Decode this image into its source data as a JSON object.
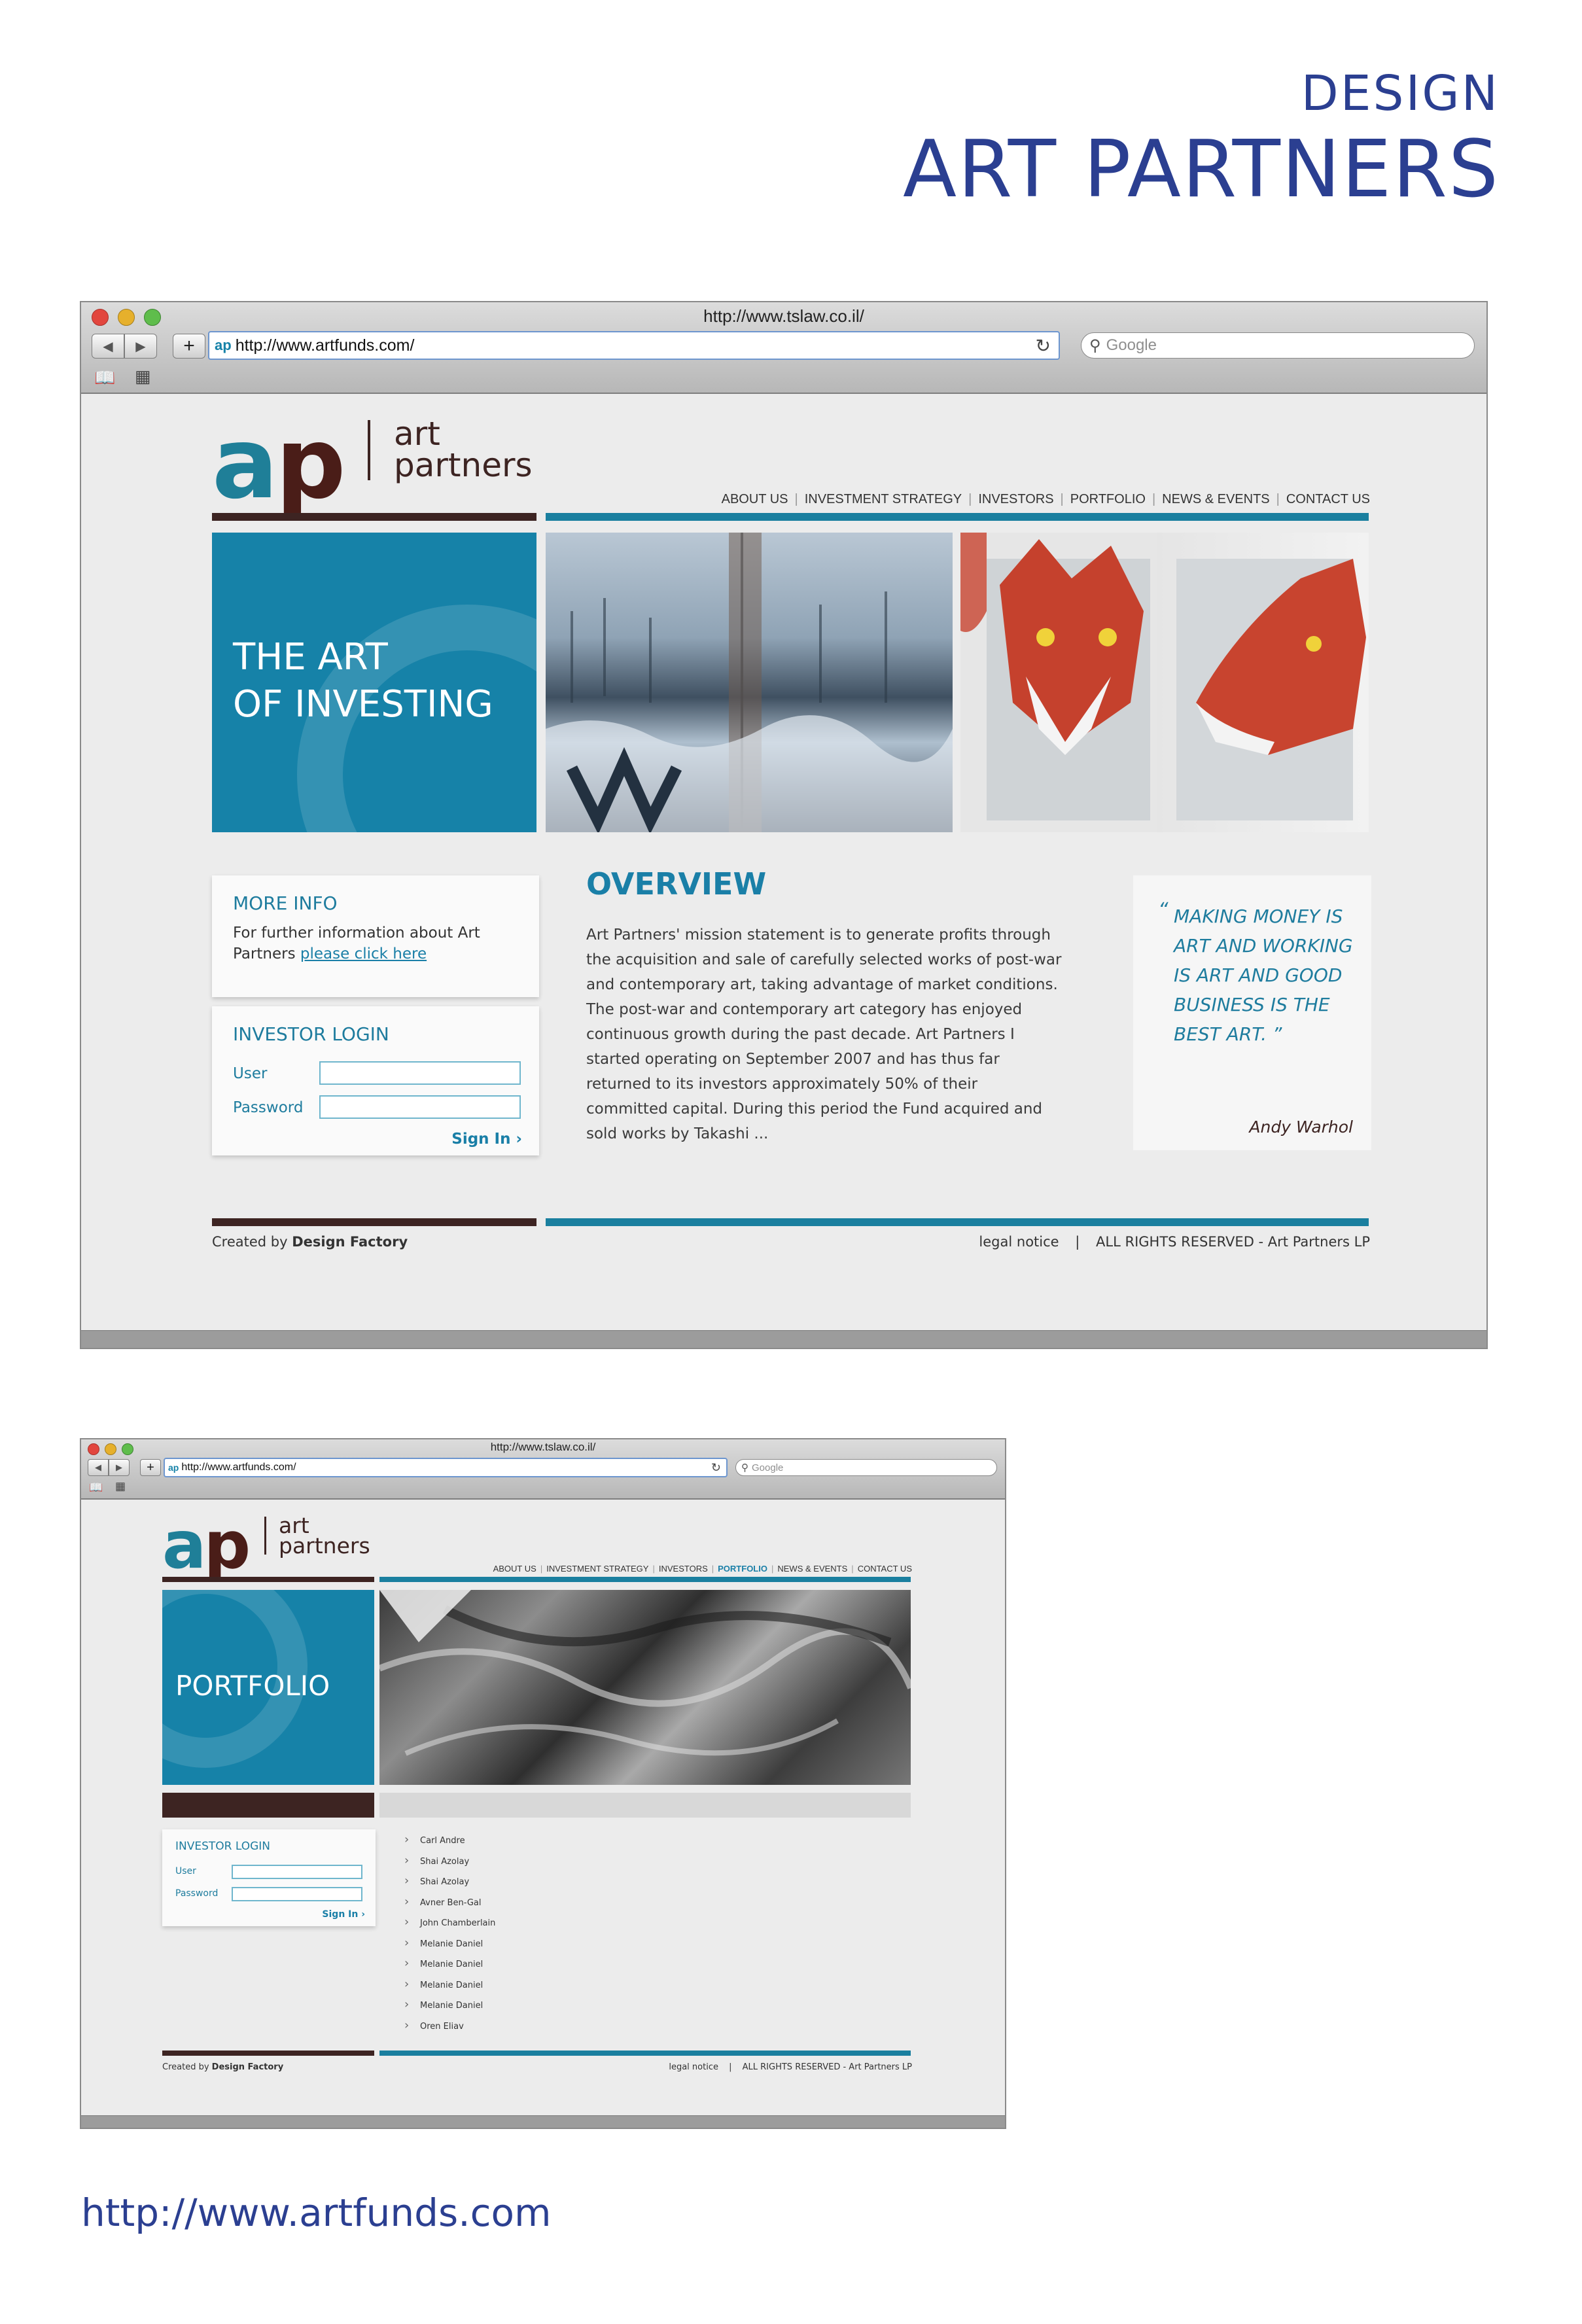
{
  "page": {
    "subtitle": "DESIGN",
    "title": "ART PARTNERS",
    "footer_url": "http://www.artfunds.com"
  },
  "browser": {
    "window_title": "http://www.tslaw.co.il/",
    "url": "http://www.artfunds.com/",
    "search_placeholder": "Google",
    "favicon_text": "ap"
  },
  "site": {
    "logo_mark": "ap",
    "logo_line1": "art",
    "logo_line2": "partners",
    "nav": [
      "ABOUT US",
      "INVESTMENT STRATEGY",
      "INVESTORS",
      "PORTFOLIO",
      "NEWS & EVENTS",
      "CONTACT US"
    ],
    "nav_separator": "|",
    "login": {
      "title": "INVESTOR LOGIN",
      "user_label": "User",
      "password_label": "Password",
      "sign_in": "Sign In",
      "sign_in_arrow": "›"
    },
    "footer": {
      "created_by": "Created by",
      "design_factory": "Design Factory",
      "legal": "legal notice",
      "separator": "|",
      "rights": "ALL RIGHTS RESERVED - Art Partners LP"
    },
    "colors": {
      "accent_blue": "#1682a8",
      "brand_brown": "#3d2422",
      "heading_blue": "#2b3f91"
    }
  },
  "home": {
    "hero_line1": "THE ART",
    "hero_line2": "OF INVESTING",
    "more_info_title": "MORE INFO",
    "more_info_text": "For further information about Art Partners",
    "more_info_link": "please click here",
    "overview_title": "OVERVIEW",
    "overview_lines": [
      "Art Partners' mission statement is to generate profits through",
      "the acquisition and sale of carefully selected works of post-war",
      "and contemporary art, taking advantage of market conditions.",
      "The post-war and contemporary art category has enjoyed",
      "continuous growth during the past decade. Art Partners I",
      "started operating on September 2007 and has thus far",
      "returned to its investors approximately 50% of their",
      "committed capital. During this period the Fund acquired and",
      "sold works by Takashi ..."
    ],
    "quote_lines": [
      "MAKING MONEY IS",
      "ART AND WORKING",
      "IS ART AND GOOD",
      "BUSINESS IS THE",
      "BEST ART."
    ],
    "quote_open": "“",
    "quote_close": "”",
    "quote_author": "Andy Warhol"
  },
  "portfolio": {
    "hero_title": "PORTFOLIO",
    "active_nav": "PORTFOLIO",
    "artists": [
      "Carl Andre",
      "Shai Azolay",
      "Shai Azolay",
      "Avner Ben-Gal",
      "John Chamberlain",
      "Melanie Daniel",
      "Melanie Daniel",
      "Melanie Daniel",
      "Melanie Daniel",
      "Oren Eliav"
    ]
  }
}
